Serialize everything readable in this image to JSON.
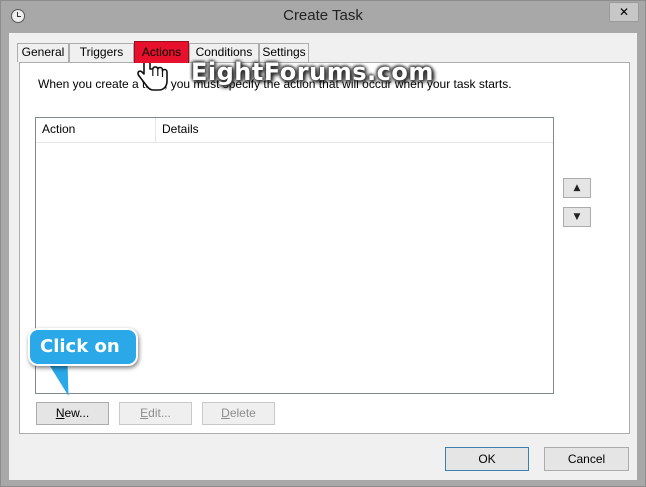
{
  "window": {
    "title": "Create Task",
    "close_label": "✕"
  },
  "tabs": [
    {
      "label": "General"
    },
    {
      "label": "Triggers"
    },
    {
      "label": "Actions",
      "active": true
    },
    {
      "label": "Conditions"
    },
    {
      "label": "Settings"
    }
  ],
  "actions_panel": {
    "instruction": "When you create a task, you must specify the action that will occur when your task starts.",
    "columns": [
      "Action",
      "Details"
    ],
    "new_label": "New...",
    "edit_label": "Edit...",
    "delete_label": "Delete",
    "move_up_label": "▲",
    "move_down_label": "▼"
  },
  "footer": {
    "ok_label": "OK",
    "cancel_label": "Cancel"
  },
  "overlay": {
    "watermark": "EightForums.com",
    "callout": "Click on"
  },
  "colors": {
    "active_tab": "#e8112d",
    "callout": "#2aa8e8",
    "dialog_bg": "#f0f0f0"
  },
  "icons": {
    "title": "clock-icon",
    "pointer": "hand-pointer-icon",
    "up": "arrow-up-icon",
    "down": "arrow-down-icon"
  }
}
